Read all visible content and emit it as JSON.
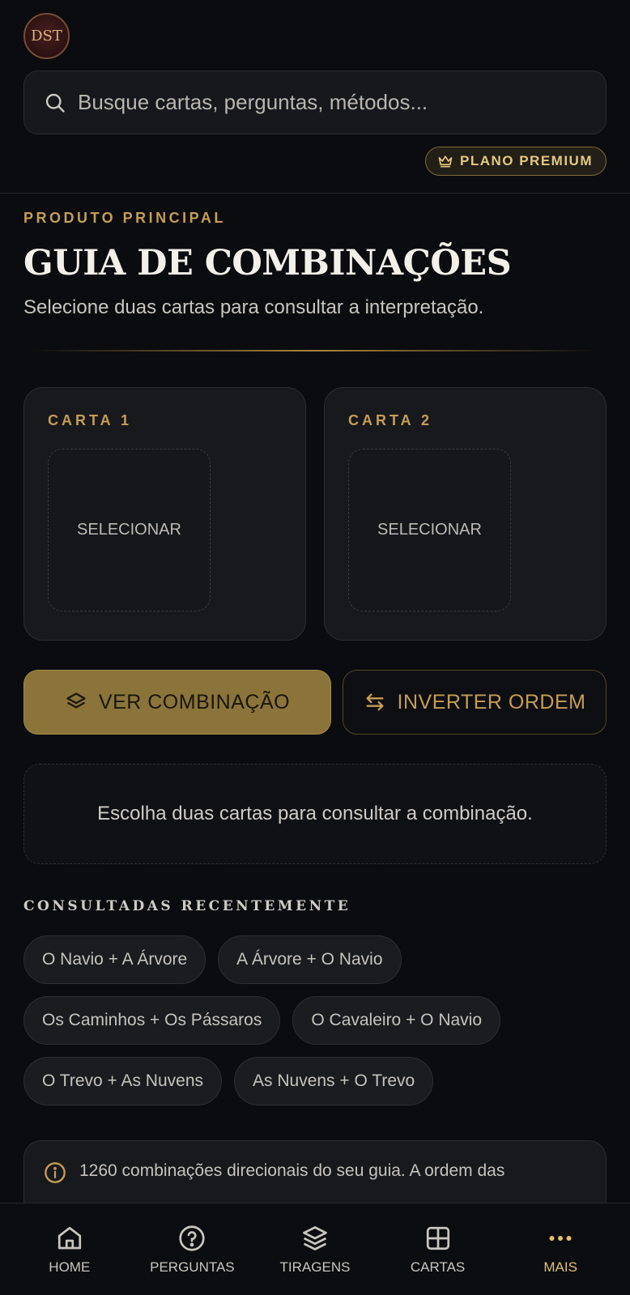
{
  "header": {
    "logo_text": "DST",
    "search_placeholder": "Busque cartas, perguntas, métodos...",
    "premium_label": "PLANO PREMIUM"
  },
  "intro": {
    "eyebrow": "PRODUTO PRINCIPAL",
    "title": "GUIA DE COMBINAÇÕES",
    "subtitle": "Selecione duas cartas para consultar a interpretação."
  },
  "cards": [
    {
      "label": "CARTA 1",
      "slot_text": "SELECIONAR"
    },
    {
      "label": "CARTA 2",
      "slot_text": "SELECIONAR"
    }
  ],
  "actions": {
    "primary_label": "VER COMBINAÇÃO",
    "secondary_label": "INVERTER ORDEM"
  },
  "hint_text": "Escolha duas cartas para consultar a combinação.",
  "recent": {
    "title": "CONSULTADAS RECENTEMENTE",
    "items": [
      "O Navio + A Árvore",
      "A Árvore + O Navio",
      "Os Caminhos + Os Pássaros",
      "O Cavaleiro + O Navio",
      "O Trevo + As Nuvens",
      "As Nuvens + O Trevo"
    ]
  },
  "info_text": "1260 combinações direcionais do seu guia. A ordem das",
  "nav": [
    {
      "label": "HOME",
      "icon": "home-icon"
    },
    {
      "label": "PERGUNTAS",
      "icon": "question-icon"
    },
    {
      "label": "TIRAGENS",
      "icon": "layers-icon"
    },
    {
      "label": "CARTAS",
      "icon": "grid-icon"
    },
    {
      "label": "MAIS",
      "icon": "more-icon"
    }
  ],
  "colors": {
    "background": "#0b0c0f",
    "accent_gold": "#c59d55",
    "primary_button": "#8b7439",
    "active_nav": "#e3c06e"
  }
}
